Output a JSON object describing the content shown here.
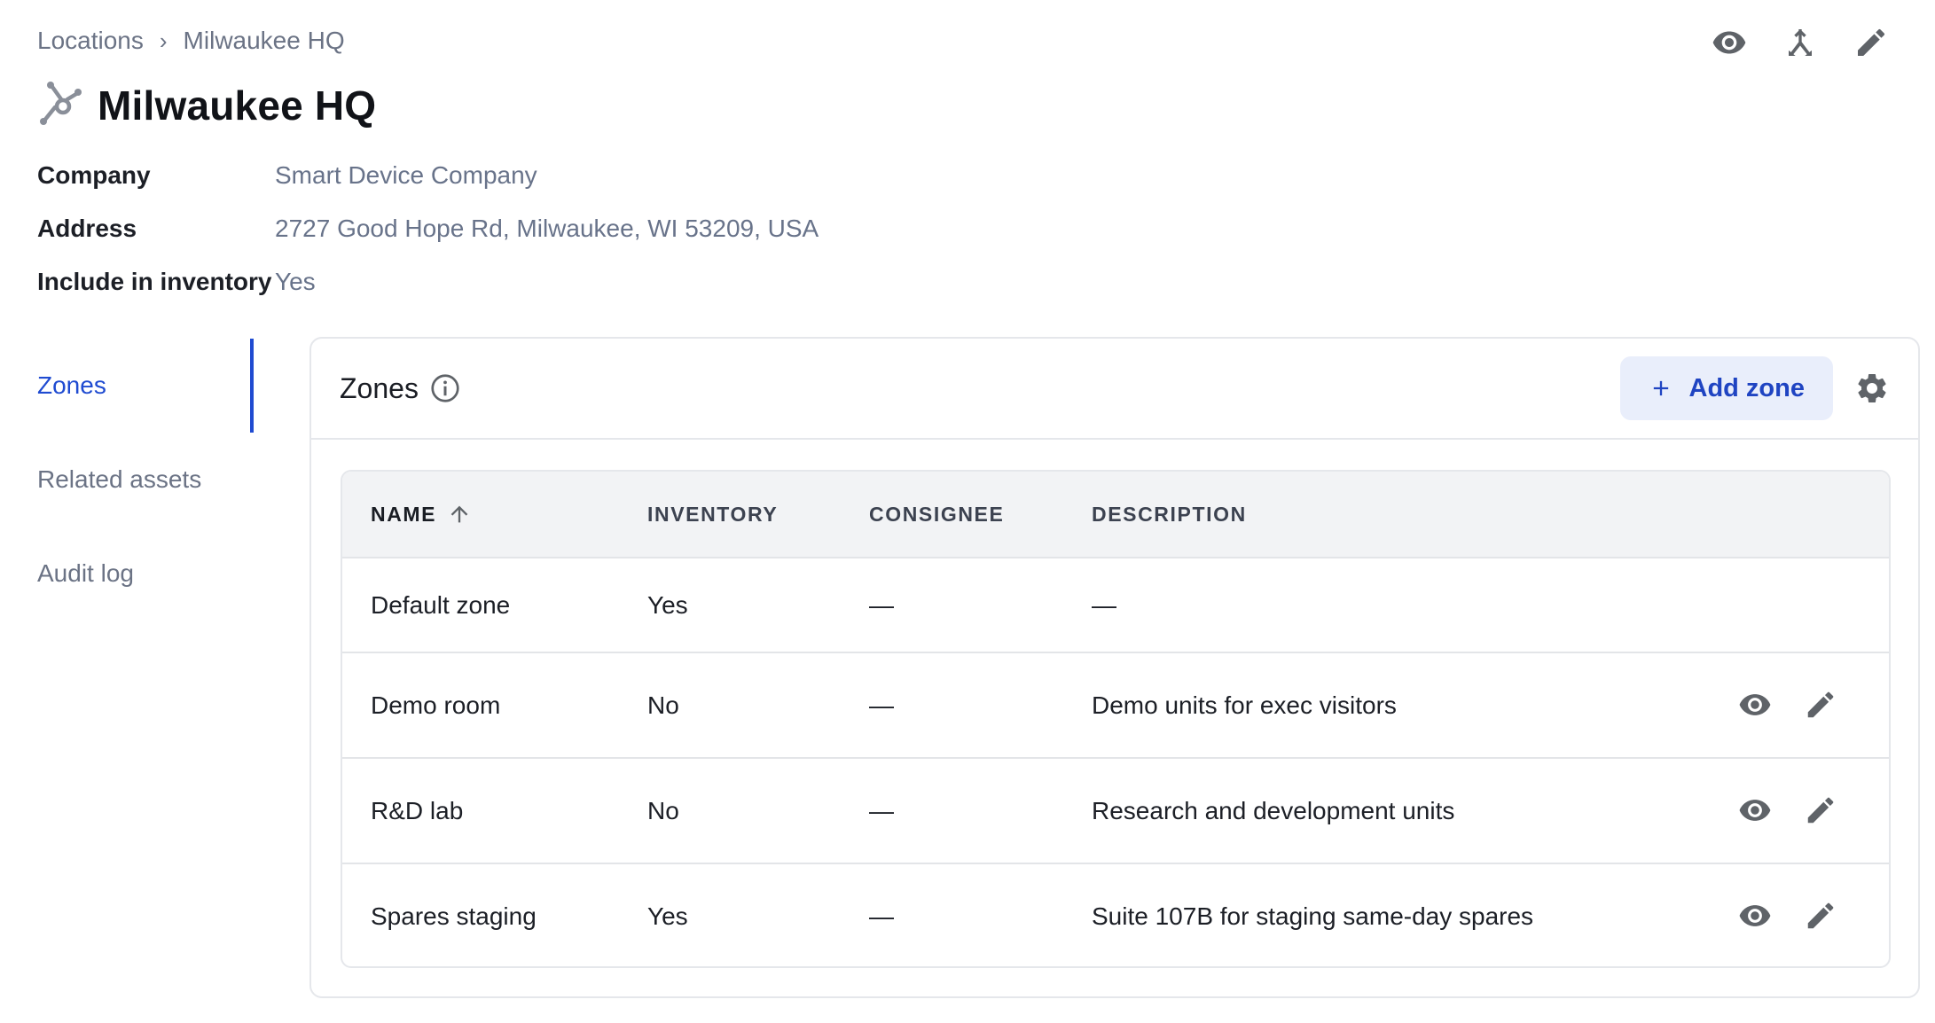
{
  "breadcrumb": {
    "parent": "Locations",
    "separator": "›",
    "current": "Milwaukee HQ"
  },
  "title": "Milwaukee HQ",
  "details": [
    {
      "label": "Company",
      "value": "Smart Device Company"
    },
    {
      "label": "Address",
      "value": "2727 Good Hope Rd, Milwaukee, WI 53209, USA"
    },
    {
      "label": "Include in inventory",
      "value": "Yes"
    }
  ],
  "sidenav": {
    "items": [
      {
        "label": "Zones",
        "active": true
      },
      {
        "label": "Related assets",
        "active": false
      },
      {
        "label": "Audit log",
        "active": false
      }
    ]
  },
  "zones_card": {
    "title": "Zones",
    "add_button": "Add zone",
    "table": {
      "columns": [
        "NAME",
        "INVENTORY",
        "CONSIGNEE",
        "DESCRIPTION"
      ],
      "sort_column": "NAME",
      "sort_direction": "ascending",
      "rows": [
        {
          "name": "Default zone",
          "inventory": "Yes",
          "consignee": "—",
          "description": "—",
          "has_actions": false
        },
        {
          "name": "Demo room",
          "inventory": "No",
          "consignee": "—",
          "description": "Demo units for exec visitors",
          "has_actions": true
        },
        {
          "name": "R&D lab",
          "inventory": "No",
          "consignee": "—",
          "description": "Research and development units",
          "has_actions": true
        },
        {
          "name": "Spares staging",
          "inventory": "Yes",
          "consignee": "—",
          "description": "Suite 107B for staging same-day spares",
          "has_actions": true
        }
      ]
    }
  },
  "icons": {
    "top_actions": [
      "eye-icon",
      "merge-icon",
      "pencil-icon"
    ],
    "title_icon": "hub-location-icon",
    "info_icon": "info-icon",
    "settings_icon": "gear-icon",
    "sort_icon": "arrow-up-icon",
    "row_actions": [
      "eye-icon",
      "pencil-icon"
    ]
  },
  "colors": {
    "accent": "#1f4bd1",
    "add_button_bg": "#e9eefb",
    "muted_text": "#6b7385",
    "table_header_bg": "#f2f3f5"
  }
}
